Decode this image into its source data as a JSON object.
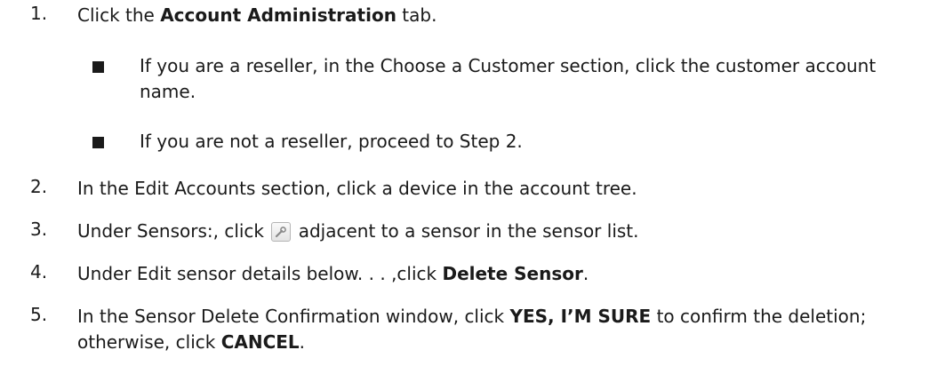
{
  "steps": [
    {
      "number": "1.",
      "pre": "Click the ",
      "bold": "Account Administration",
      "post": " tab.",
      "subitems": [
        {
          "text": "If you are a reseller, in the Choose a Customer section, click the customer account name."
        },
        {
          "text": "If you are not a reseller, proceed to Step 2."
        }
      ]
    },
    {
      "number": "2.",
      "text": "In the Edit Accounts section, click a device in the account tree."
    },
    {
      "number": "3.",
      "pre": "Under Sensors:, click ",
      "icon": "wrench-icon",
      "post": " adjacent to a sensor in the sensor list."
    },
    {
      "number": "4.",
      "pre": "Under Edit sensor details below. . . ,click ",
      "bold": "Delete Sensor",
      "post": "."
    },
    {
      "number": "5.",
      "pre": "In the Sensor Delete Confirmation window, click ",
      "bold": "YES, I’M SURE",
      "mid": " to confirm the deletion; otherwise, click ",
      "bold2": "CANCEL",
      "post": "."
    }
  ]
}
